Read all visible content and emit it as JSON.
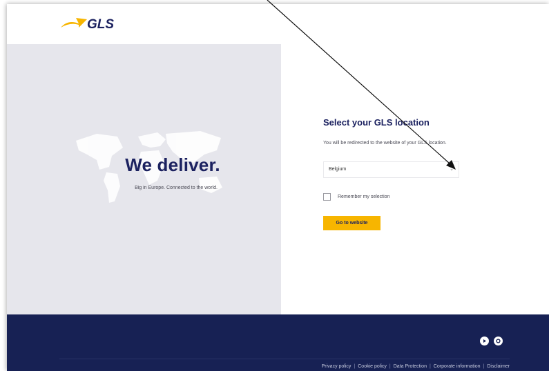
{
  "brand": {
    "logo_text": "GLS",
    "accent": "#f7b500",
    "navy": "#172154"
  },
  "hero": {
    "title": "We deliver.",
    "subtitle": "Big in Europe. Connected to the world."
  },
  "location": {
    "title": "Select your GLS location",
    "description": "You will be redirected to the website of your GLS location.",
    "selected_country": "Belgium",
    "remember_label": "Remember my selection",
    "button_label": "Go to website"
  },
  "footer": {
    "links": [
      "Privacy policy",
      "Cookie policy",
      "Data Protection",
      "Corporate information",
      "Disclaimer"
    ],
    "separator": "|",
    "social_icons": [
      "youtube-icon",
      "instagram-icon"
    ]
  }
}
